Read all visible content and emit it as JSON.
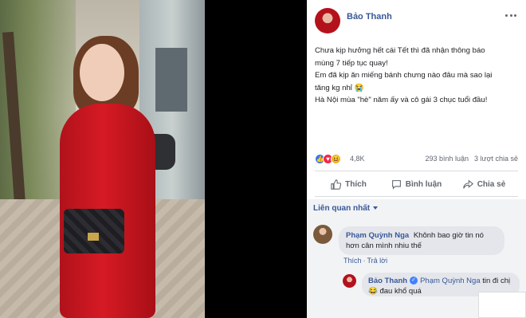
{
  "post": {
    "author": "Bảo Thanh",
    "lines": [
      "Chưa kịp hưởng hết cái Tết thì đã nhận thông báo",
      "mùng 7 tiếp tục quay!",
      "Em đã kịp ăn miếng bánh chưng nào đâu mà sao lại",
      "tăng kg nhỉ 😭",
      "Hà Nội mùa \"hè\" năm ấy và cô gái 3 chục tuổi đầu!"
    ],
    "reaction_count": "4,8K",
    "comment_count": "293 bình luận",
    "share_count": "3 lượt chia sẻ",
    "reaction_icons": [
      "like-icon",
      "love-icon",
      "haha-icon"
    ]
  },
  "actions": {
    "like_label": "Thích",
    "comment_label": "Bình luận",
    "share_label": "Chia sẻ"
  },
  "comments": {
    "sort_label": "Liên quan nhất",
    "first": {
      "author": "Phạm Quỳnh Nga",
      "text": "Khônh bao giờ tin nó hơn cân mình nhiu thế",
      "like_label": "Thích",
      "reply_label": "Trả lời"
    },
    "reply": {
      "author": "Bảo Thanh",
      "mention": "Phạm Quỳnh Nga",
      "text": "tin đi chị 😂 đau khổ quá"
    }
  },
  "colors": {
    "link": "#385898",
    "like": "#3578e5",
    "love": "#f0284a",
    "haha": "#f7b125",
    "dress": "#d61a24"
  }
}
